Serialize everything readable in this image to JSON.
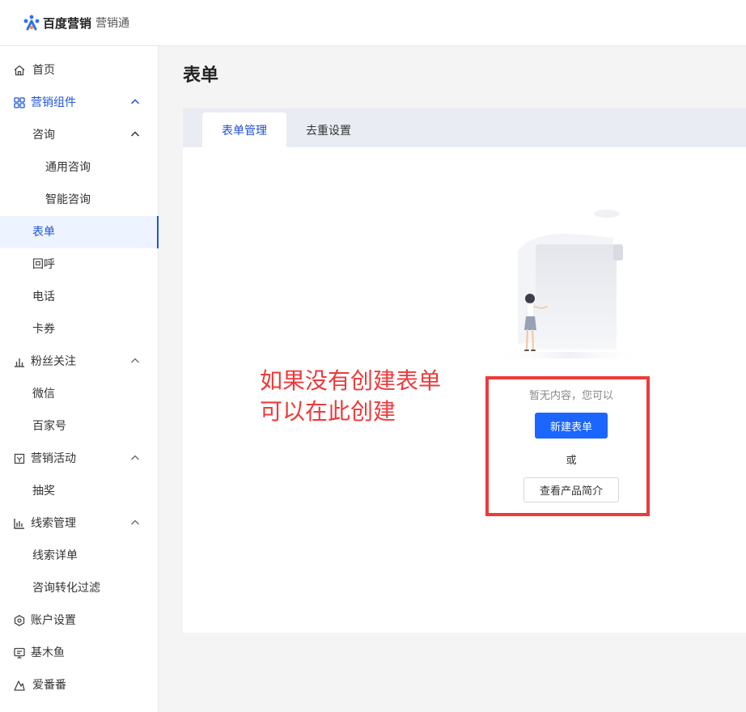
{
  "header": {
    "brand": "百度营销",
    "product": "营销通"
  },
  "sidebar": {
    "items": [
      {
        "label": "首页",
        "icon": "home-icon"
      },
      {
        "label": "营销组件",
        "icon": "grid-icon"
      },
      {
        "label": "咨询"
      },
      {
        "label": "通用咨询"
      },
      {
        "label": "智能咨询"
      },
      {
        "label": "表单"
      },
      {
        "label": "回呼"
      },
      {
        "label": "电话"
      },
      {
        "label": "卡券"
      },
      {
        "label": "粉丝关注",
        "icon": "bar-chart-icon"
      },
      {
        "label": "微信"
      },
      {
        "label": "百家号"
      },
      {
        "label": "营销活动",
        "icon": "gift-icon"
      },
      {
        "label": "抽奖"
      },
      {
        "label": "线索管理",
        "icon": "column-chart-icon"
      },
      {
        "label": "线索详单"
      },
      {
        "label": "咨询转化过滤"
      },
      {
        "label": "账户设置",
        "icon": "hexagon-icon"
      },
      {
        "label": "基木鱼",
        "icon": "monitor-icon"
      },
      {
        "label": "爱番番",
        "icon": "aifanfan-icon"
      }
    ]
  },
  "main": {
    "title": "表单",
    "tabs": [
      {
        "label": "表单管理"
      },
      {
        "label": "去重设置"
      }
    ],
    "empty": {
      "text": "暂无内容，您可以",
      "primary_button": "新建表单",
      "or": "或",
      "secondary_button": "查看产品简介"
    },
    "annotation": {
      "line1": "如果没有创建表单",
      "line2": "可以在此创建"
    }
  },
  "colors": {
    "accent": "#1a66ff",
    "annotation": "#ee3a3a",
    "active_nav": "#1f55d6"
  }
}
